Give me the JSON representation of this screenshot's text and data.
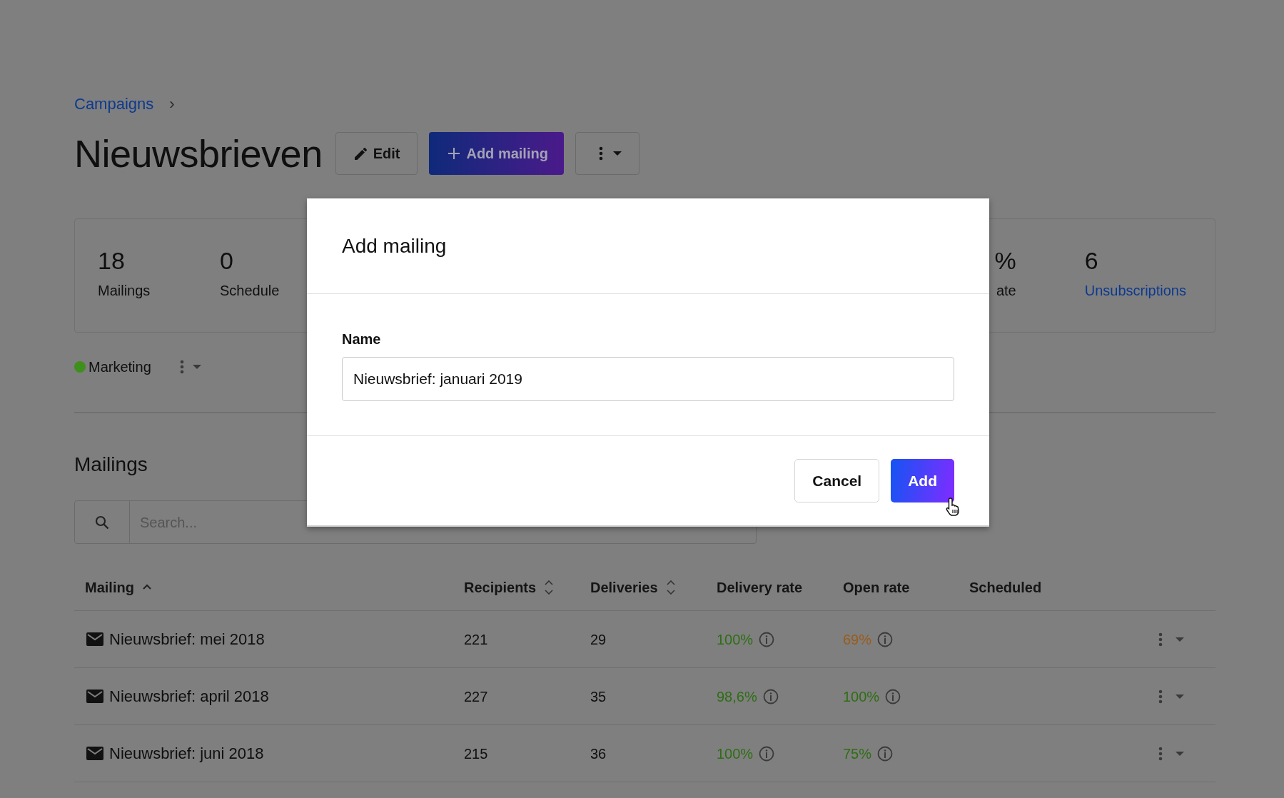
{
  "breadcrumb": {
    "link": "Campaigns",
    "separator": "›"
  },
  "title": "Nieuwsbrieven",
  "header_buttons": [
    {
      "kind": "edit",
      "label": "Edit"
    },
    {
      "kind": "primary",
      "label": "Add mailing"
    },
    {
      "kind": "menu"
    }
  ],
  "stats": [
    {
      "value": "18",
      "label": "Mailings",
      "link": false
    },
    {
      "value": "0",
      "label": "Schedule",
      "link": false
    },
    {
      "value": "%",
      "label": "ate",
      "link": false
    },
    {
      "value": "6",
      "label": "Unsubscriptions",
      "link": true
    }
  ],
  "tag": {
    "label": "Marketing",
    "color": "#3f8f1c"
  },
  "section_title": "Mailings",
  "search": {
    "placeholder": "Search..."
  },
  "table": {
    "columns": [
      {
        "label": "Mailing",
        "sortable": true,
        "sorted": true
      },
      {
        "label": "Recipients",
        "sortable": true,
        "sorted": false
      },
      {
        "label": "Deliveries",
        "sortable": true,
        "sorted": false
      },
      {
        "label": "Delivery rate",
        "sortable": false,
        "sorted": false
      },
      {
        "label": "Open rate",
        "sortable": false,
        "sorted": false
      },
      {
        "label": "Scheduled",
        "sortable": false,
        "sorted": false
      }
    ],
    "rows": [
      {
        "name": "Nieuwsbrief: mei 2018",
        "recipients": "221",
        "deliveries": "29",
        "delivery_rate": {
          "text": "100%",
          "color": "#2f6e14"
        },
        "open_rate": {
          "text": "69%",
          "color": "#9a5c1c"
        }
      },
      {
        "name": "Nieuwsbrief: april 2018",
        "recipients": "227",
        "deliveries": "35",
        "delivery_rate": {
          "text": "98,6%",
          "color": "#2f6e14"
        },
        "open_rate": {
          "text": "100%",
          "color": "#2f6e14"
        }
      },
      {
        "name": "Nieuwsbrief: juni 2018",
        "recipients": "215",
        "deliveries": "36",
        "delivery_rate": {
          "text": "100%",
          "color": "#2f6e14"
        },
        "open_rate": {
          "text": "75%",
          "color": "#2f6e14"
        }
      }
    ]
  },
  "modal": {
    "title": "Add mailing",
    "field_label": "Name",
    "field_value": "Nieuwsbrief: januari 2019",
    "buttons": [
      {
        "kind": "secondary",
        "label": "Cancel"
      },
      {
        "kind": "primary",
        "label": "Add",
        "hovered": true
      }
    ]
  }
}
